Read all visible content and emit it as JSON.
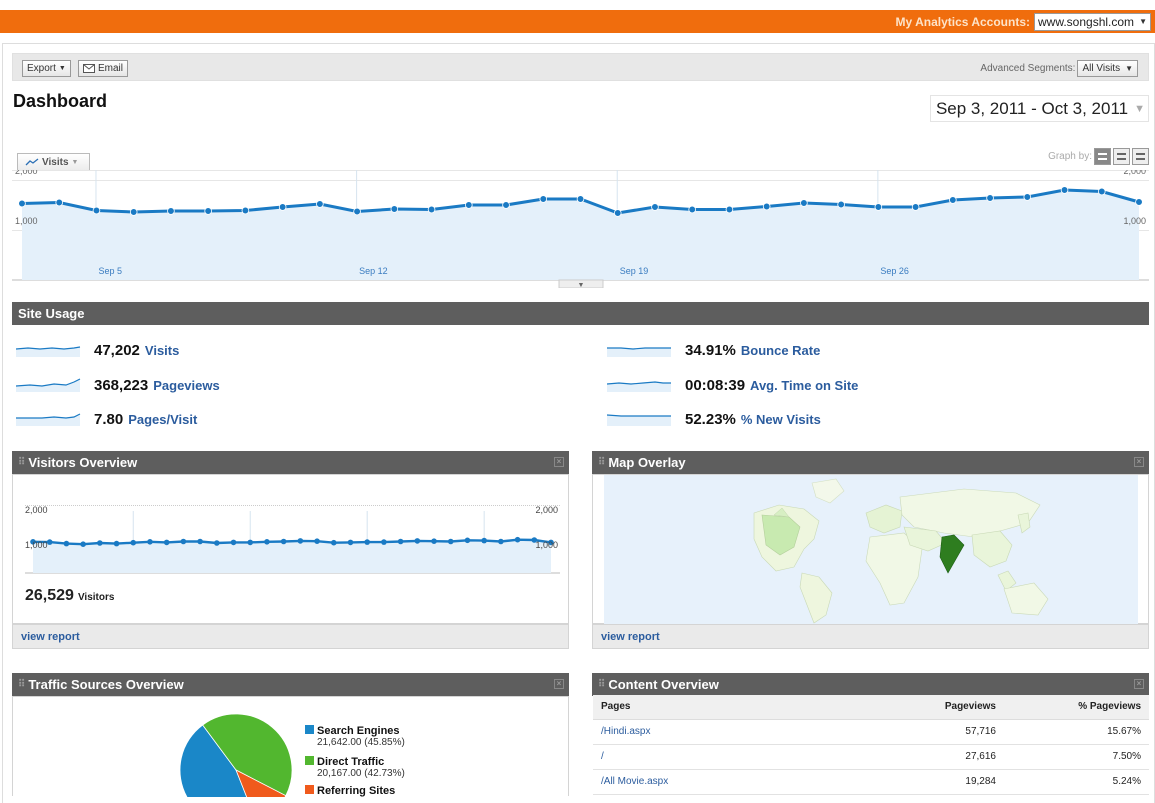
{
  "top": {
    "label": "My Analytics Accounts:",
    "account": "www.songshl.com"
  },
  "toolbar": {
    "export": "Export",
    "email": "Email",
    "segments_label": "Advanced Segments:",
    "segments_value": "All Visits"
  },
  "page": {
    "title": "Dashboard",
    "date_range": "Sep 3, 2011 - Oct 3, 2011"
  },
  "graph": {
    "metric": "Visits",
    "graph_by": "Graph by:"
  },
  "chart_data": [
    {
      "type": "line",
      "series": [
        {
          "name": "Visits",
          "values": [
            1530,
            1550,
            1390,
            1360,
            1380,
            1380,
            1390,
            1460,
            1520,
            1370,
            1420,
            1410,
            1500,
            1500,
            1620,
            1620,
            1340,
            1460,
            1410,
            1410,
            1470,
            1540,
            1510,
            1460,
            1460,
            1600,
            1640,
            1660,
            1800,
            1770,
            1560
          ]
        }
      ],
      "x_tick_labels": [
        "Sep 5",
        "Sep 12",
        "Sep 19",
        "Sep 26"
      ],
      "y_tick_labels": [
        "2,000",
        "1,000"
      ],
      "ylim": [
        0,
        2200
      ],
      "grid": true
    },
    {
      "type": "line",
      "series": [
        {
          "name": "Visitors",
          "values": [
            1040,
            1030,
            980,
            960,
            1000,
            980,
            1010,
            1040,
            1020,
            1050,
            1050,
            1000,
            1020,
            1020,
            1040,
            1050,
            1070,
            1060,
            1010,
            1020,
            1030,
            1030,
            1050,
            1070,
            1060,
            1050,
            1090,
            1080,
            1050,
            1110,
            1100,
            1020
          ]
        }
      ],
      "y_tick_labels": [
        "2,000",
        "1,000"
      ],
      "ylim": [
        0,
        2400
      ],
      "grid": true
    },
    {
      "type": "pie",
      "slices": [
        {
          "name": "Search Engines",
          "value": 45.85,
          "color": "#1a87c8"
        },
        {
          "name": "Direct Traffic",
          "value": 42.73,
          "color": "#52b72f"
        },
        {
          "name": "Referring Sites",
          "value": 11.42,
          "color": "#f05a1c"
        }
      ]
    }
  ],
  "site_usage": {
    "title": "Site Usage",
    "items": [
      {
        "value": "47,202",
        "label": "Visits"
      },
      {
        "value": "368,223",
        "label": "Pageviews"
      },
      {
        "value": "7.80",
        "label": "Pages/Visit"
      },
      {
        "value": "34.91%",
        "label": "Bounce Rate"
      },
      {
        "value": "00:08:39",
        "label": "Avg. Time on Site"
      },
      {
        "value": "52.23%",
        "label": "% New Visits"
      }
    ]
  },
  "visitors": {
    "title": "Visitors Overview",
    "count": "26,529",
    "count_label": "Visitors",
    "link": "view report"
  },
  "map": {
    "title": "Map Overlay",
    "link": "view report"
  },
  "traffic": {
    "title": "Traffic Sources Overview",
    "legend": [
      {
        "name": "Search Engines",
        "value": "21,642.00 (45.85%)"
      },
      {
        "name": "Direct Traffic",
        "value": "20,167.00 (42.73%)"
      },
      {
        "name": "Referring Sites",
        "value": ""
      }
    ]
  },
  "content": {
    "title": "Content Overview",
    "headers": [
      "Pages",
      "Pageviews",
      "% Pageviews"
    ],
    "rows": [
      [
        "/Hindi.aspx",
        "57,716",
        "15.67%"
      ],
      [
        "/",
        "27,616",
        "7.50%"
      ],
      [
        "/All Movie.aspx",
        "19,284",
        "5.24%"
      ]
    ]
  },
  "colors": {
    "brand": "#f06d0d",
    "header": "#5e5e5e",
    "line": "#1a7ac4",
    "fill": "#e4f0fa",
    "link": "#2b5c9e"
  }
}
